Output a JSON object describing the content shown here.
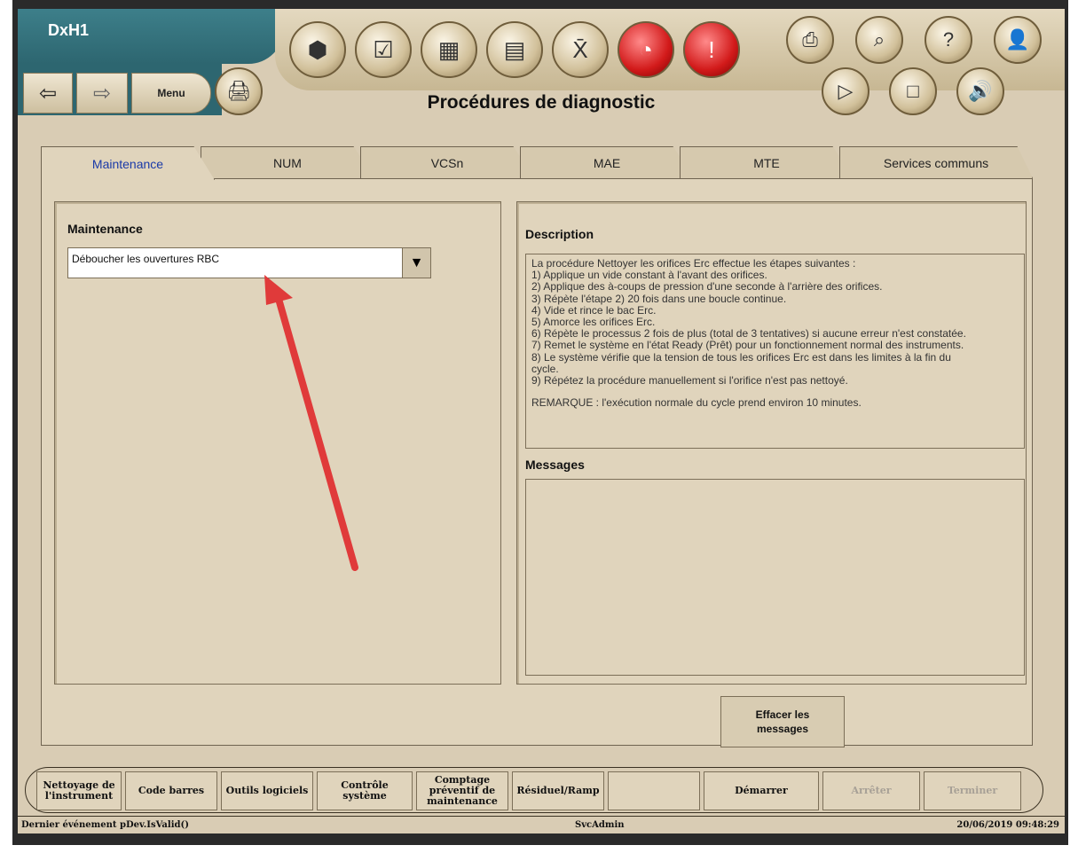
{
  "app": {
    "brand": "DxH1",
    "title": "Procédures de diagnostic"
  },
  "nav": {
    "back_icon": "arrow-left-icon",
    "forward_icon": "arrow-right-icon",
    "menu_label": "Menu"
  },
  "toolbar": {
    "icons": [
      "cubes-icon",
      "checkbox-icon",
      "calendar-icon",
      "chart-icon",
      "xbar-icon",
      "gauge-icon",
      "alert-icon"
    ],
    "right_icons": [
      "printer-icon",
      "magnifier-icon",
      "help-icon",
      "user-icon"
    ],
    "media_icons": [
      "play-icon",
      "stop-icon",
      "speaker-icon"
    ]
  },
  "tabs": [
    {
      "label": "Maintenance"
    },
    {
      "label": "NUM"
    },
    {
      "label": "VCSn"
    },
    {
      "label": "MAE"
    },
    {
      "label": "MTE"
    },
    {
      "label": "Services communs"
    }
  ],
  "left": {
    "title": "Maintenance",
    "selected": "Déboucher les ouvertures RBC"
  },
  "right": {
    "title": "Description",
    "description_lines": [
      "La procédure Nettoyer les orifices Erc effectue les étapes suivantes :",
      "1) Applique un vide constant à l'avant des orifices.",
      "2) Applique des à-coups de pression d'une seconde à l'arrière des orifices.",
      "3) Répète l'étape 2) 20 fois dans une boucle continue.",
      "4) Vide et rince le bac Erc.",
      "5) Amorce les orifices Erc.",
      "6) Répète le processus 2 fois de plus (total de 3 tentatives) si aucune erreur n'est constatée.",
      "7) Remet le système en l'état Ready (Prêt) pour un fonctionnement normal des instruments.",
      "8) Le système vérifie que la tension de tous les orifices Erc est dans les limites à la fin du",
      "cycle.",
      "9) Répétez la procédure manuellement si l'orifice n'est pas nettoyé."
    ],
    "note": "REMARQUE : l'exécution normale du cycle prend environ 10 minutes.",
    "messages_title": "Messages"
  },
  "clear_button": {
    "line1": "Effacer les",
    "line2": "messages"
  },
  "actions": [
    {
      "label": "Nettoyage de l'instrument"
    },
    {
      "label": "Code barres"
    },
    {
      "label": "Outils logiciels"
    },
    {
      "label": "Contrôle système"
    },
    {
      "label": "Comptage préventif de maintenance"
    },
    {
      "label": "Résiduel/Ramp"
    },
    {
      "label": ""
    },
    {
      "label": "Démarrer"
    },
    {
      "label": "Arrêter"
    },
    {
      "label": "Terminer"
    }
  ],
  "status": {
    "event": "Dernier événement pDev.IsValid()",
    "user": "SvcAdmin",
    "datetime": "20/06/2019 09:48:29"
  },
  "colors": {
    "accent_tab_text": "#1a3aa8",
    "alert": "#d21a1a",
    "arrow": "#e03a3a"
  }
}
